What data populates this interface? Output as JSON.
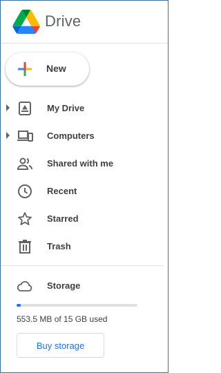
{
  "app": {
    "name": "Drive",
    "logo_icon": "google-drive-logo"
  },
  "new_button": {
    "label": "New",
    "icon": "plus-icon"
  },
  "nav": {
    "items": [
      {
        "label": "My Drive",
        "icon": "my-drive-icon",
        "expandable": true
      },
      {
        "label": "Computers",
        "icon": "computers-icon",
        "expandable": true
      },
      {
        "label": "Shared with me",
        "icon": "shared-with-me-icon",
        "expandable": false
      },
      {
        "label": "Recent",
        "icon": "clock-icon",
        "expandable": false
      },
      {
        "label": "Starred",
        "icon": "star-icon",
        "expandable": false
      },
      {
        "label": "Trash",
        "icon": "trash-icon",
        "expandable": false
      }
    ]
  },
  "storage": {
    "label": "Storage",
    "icon": "cloud-icon",
    "usage_text": "553.5 MB of 15 GB used",
    "used_fraction": 0.036,
    "buy_label": "Buy storage"
  },
  "colors": {
    "accent": "#1a73e8",
    "text": "#3c4043",
    "icon": "#5f6368",
    "border": "#3b6fa5"
  }
}
